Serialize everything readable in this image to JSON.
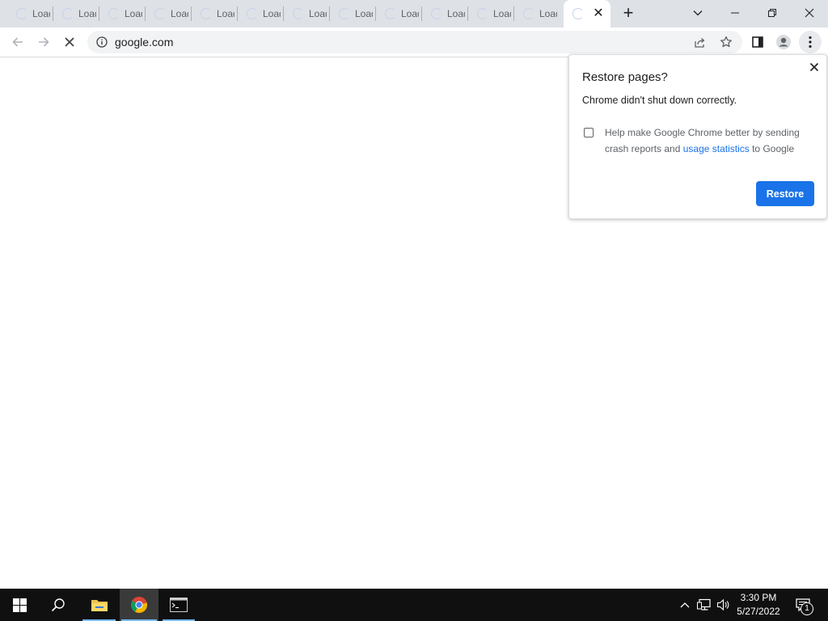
{
  "browser": {
    "tabs": [
      {
        "title": "Loading"
      },
      {
        "title": "Loading"
      },
      {
        "title": "Loading"
      },
      {
        "title": "Loading"
      },
      {
        "title": "Loading"
      },
      {
        "title": "Loading"
      },
      {
        "title": "Loading"
      },
      {
        "title": "Loading"
      },
      {
        "title": "Loading"
      },
      {
        "title": "Loading"
      },
      {
        "title": "Loading"
      },
      {
        "title": "Loading"
      }
    ],
    "active_tab_close": "✕",
    "new_tab_label": "+",
    "address": "google.com"
  },
  "bubble": {
    "title": "Restore pages?",
    "message": "Chrome didn't shut down correctly.",
    "checkbox_text_before": "Help make Google Chrome better by sending crash reports and ",
    "checkbox_link": "usage statistics",
    "checkbox_text_after": " to Google",
    "checkbox_checked": false,
    "restore_button": "Restore"
  },
  "taskbar": {
    "time": "3:30 PM",
    "date": "5/27/2022",
    "notifications_count": "1",
    "items": [
      "start",
      "search",
      "file-explorer",
      "chrome",
      "terminal"
    ]
  },
  "colors": {
    "accent": "#1a73e8",
    "tabstrip": "#dee1e6",
    "taskbar": "#101010"
  }
}
